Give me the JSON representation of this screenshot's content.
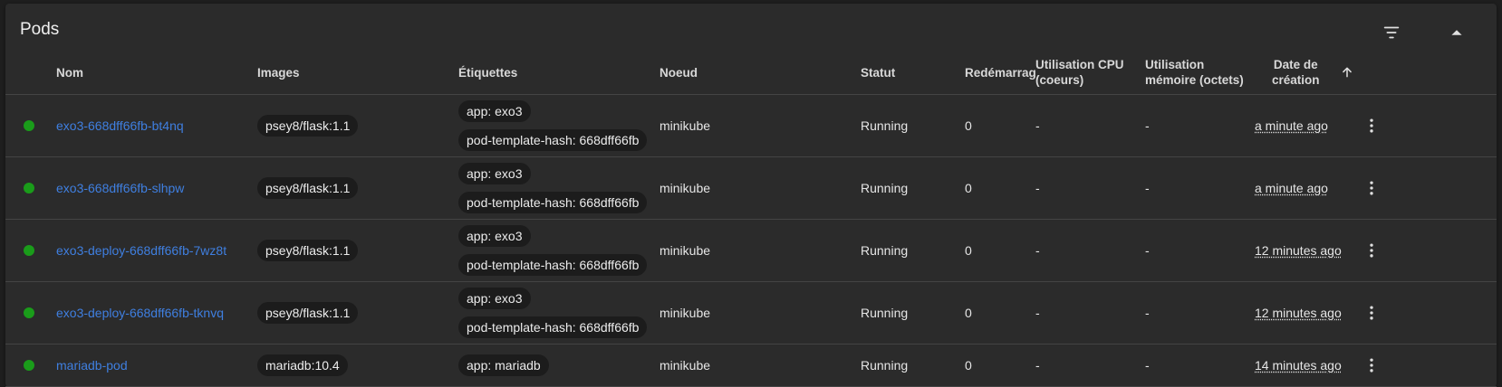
{
  "card": {
    "title": "Pods"
  },
  "colors": {
    "status_running": "#1a9c1a",
    "link": "#3f7fe0"
  },
  "icons": {
    "filter": "filter-icon",
    "collapse": "arrow-up-icon",
    "sort": "arrow-up-icon",
    "row_menu": "more-vertical-icon"
  },
  "columns": {
    "name": "Nom",
    "images": "Images",
    "labels": "Étiquettes",
    "node": "Noeud",
    "status": "Statut",
    "restarts": "Redémarrages",
    "cpu": "Utilisation CPU\n(coeurs)",
    "memory": "Utilisation\nmémoire (octets)",
    "created": "Date de\ncréation"
  },
  "rows": [
    {
      "name": "exo3-668dff66fb-bt4nq",
      "image": "psey8/flask:1.1",
      "labels": [
        "app: exo3",
        "pod-template-hash: 668dff66fb"
      ],
      "node": "minikube",
      "status": "Running",
      "restarts": "0",
      "cpu": "-",
      "memory": "-",
      "created": "a minute ago"
    },
    {
      "name": "exo3-668dff66fb-slhpw",
      "image": "psey8/flask:1.1",
      "labels": [
        "app: exo3",
        "pod-template-hash: 668dff66fb"
      ],
      "node": "minikube",
      "status": "Running",
      "restarts": "0",
      "cpu": "-",
      "memory": "-",
      "created": "a minute ago"
    },
    {
      "name": "exo3-deploy-668dff66fb-7wz8t",
      "image": "psey8/flask:1.1",
      "labels": [
        "app: exo3",
        "pod-template-hash: 668dff66fb"
      ],
      "node": "minikube",
      "status": "Running",
      "restarts": "0",
      "cpu": "-",
      "memory": "-",
      "created": "12 minutes ago"
    },
    {
      "name": "exo3-deploy-668dff66fb-tknvq",
      "image": "psey8/flask:1.1",
      "labels": [
        "app: exo3",
        "pod-template-hash: 668dff66fb"
      ],
      "node": "minikube",
      "status": "Running",
      "restarts": "0",
      "cpu": "-",
      "memory": "-",
      "created": "12 minutes ago"
    },
    {
      "name": "mariadb-pod",
      "image": "mariadb:10.4",
      "labels": [
        "app: mariadb"
      ],
      "node": "minikube",
      "status": "Running",
      "restarts": "0",
      "cpu": "-",
      "memory": "-",
      "created": "14 minutes ago"
    }
  ]
}
